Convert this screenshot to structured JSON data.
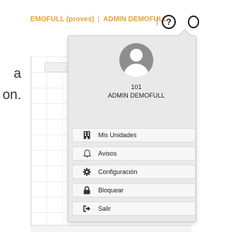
{
  "topbar": {
    "company_label": "EMOFULL (proves)",
    "separator": "|",
    "user_label": "ADMIN DEMOFULL",
    "help_icon": "help-circle-icon",
    "help_glyph": "?"
  },
  "background": {
    "text_lines": [
      "a",
      "on."
    ]
  },
  "dropdown": {
    "avatar_icon": "user-avatar-icon",
    "user_id": "101",
    "user_name": "ADMIN DEMOFULL",
    "menu": [
      {
        "label": "Mis Unidades",
        "icon": "building-icon"
      },
      {
        "label": "Avisos",
        "icon": "bell-icon"
      },
      {
        "label": "Configuración",
        "icon": "gear-icon"
      },
      {
        "label": "Bloquear",
        "icon": "lock-icon"
      },
      {
        "label": "Salir",
        "icon": "sign-out-icon"
      }
    ]
  },
  "colors": {
    "accent": "#e8a23a",
    "panel_bg": "#e9e9e9",
    "avatar_bg": "#8e8e8e"
  }
}
